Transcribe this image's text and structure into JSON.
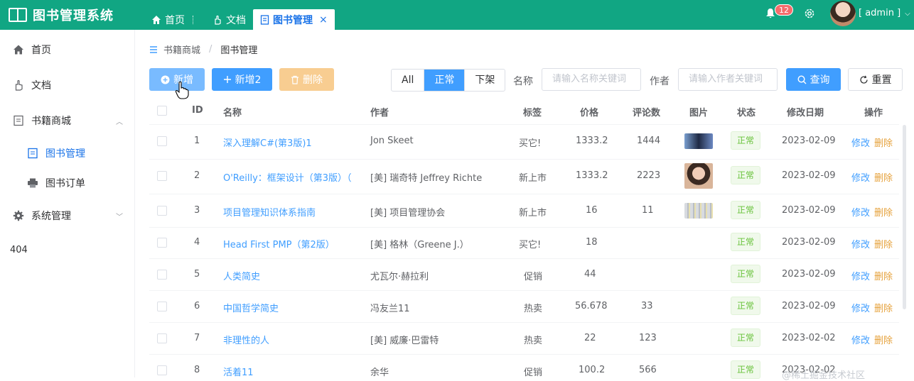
{
  "app": {
    "title": "图书管理系统"
  },
  "tabs": [
    {
      "label": "首页"
    },
    {
      "label": "文档"
    },
    {
      "label": "图书管理"
    }
  ],
  "header": {
    "notifications": "12",
    "user": "[ admin ]"
  },
  "sidebar": {
    "items": [
      {
        "label": "首页"
      },
      {
        "label": "文档"
      },
      {
        "label": "书籍商城"
      },
      {
        "label": "图书管理"
      },
      {
        "label": "图书订单"
      },
      {
        "label": "系统管理"
      },
      {
        "label": "404"
      }
    ]
  },
  "breadcrumb": {
    "parent": "书籍商城",
    "current": "图书管理"
  },
  "toolbar": {
    "add": "新增",
    "add2": "新增2",
    "delete": "删除",
    "filter": [
      "All",
      "正常",
      "下架"
    ],
    "name_label": "名称",
    "name_placeholder": "请输入名称关键词",
    "author_label": "作者",
    "author_placeholder": "请输入作者关键词",
    "search": "查询",
    "reset": "重置"
  },
  "table": {
    "columns": [
      "ID",
      "名称",
      "作者",
      "标签",
      "价格",
      "评论数",
      "图片",
      "状态",
      "修改日期",
      "操作"
    ],
    "rows": [
      {
        "id": "1",
        "name": "深入理解C#(第3版)1",
        "author": "Jon Skeet",
        "tag": "买它!",
        "price": "1333.2",
        "comments": "1444",
        "status": "正常",
        "date": "2023-02-09",
        "img": true
      },
      {
        "id": "2",
        "name": "O'Reilly：框架设计（第3版）（",
        "author": "[美] 瑞奇特 Jeffrey Richte",
        "tag": "新上市",
        "price": "1333.2",
        "comments": "2223",
        "status": "正常",
        "date": "2023-02-09",
        "img": true
      },
      {
        "id": "3",
        "name": "项目管理知识体系指南",
        "author": "[美] 项目管理协会",
        "tag": "新上市",
        "price": "16",
        "comments": "11",
        "status": "正常",
        "date": "2023-02-09",
        "img": true
      },
      {
        "id": "4",
        "name": "Head First PMP（第2版）",
        "author": "[美] 格林（Greene J.）",
        "tag": "买它!",
        "price": "18",
        "comments": "",
        "status": "正常",
        "date": "2023-02-09",
        "img": false
      },
      {
        "id": "5",
        "name": "人类简史",
        "author": "尤瓦尔·赫拉利",
        "tag": "促销",
        "price": "44",
        "comments": "",
        "status": "正常",
        "date": "2023-02-09",
        "img": false
      },
      {
        "id": "6",
        "name": "中国哲学简史",
        "author": "冯友兰11",
        "tag": "热卖",
        "price": "56.678",
        "comments": "33",
        "status": "正常",
        "date": "2023-02-09",
        "img": false
      },
      {
        "id": "7",
        "name": "非理性的人",
        "author": "[美] 威廉·巴雷特",
        "tag": "热卖",
        "price": "22",
        "comments": "123",
        "status": "正常",
        "date": "2023-02-02",
        "img": false
      },
      {
        "id": "8",
        "name": "活着11",
        "author": "余华",
        "tag": "促销",
        "price": "100.2",
        "comments": "566",
        "status": "正常",
        "date": "2023-02-02",
        "img": false
      }
    ],
    "actions": {
      "edit": "修改",
      "delete": "删除"
    }
  },
  "watermark": "@稀土掘金技术社区",
  "colors": {
    "header": "#11a683",
    "primary": "#409eff",
    "warning": "#e6a23c",
    "success": "#67c23a"
  }
}
